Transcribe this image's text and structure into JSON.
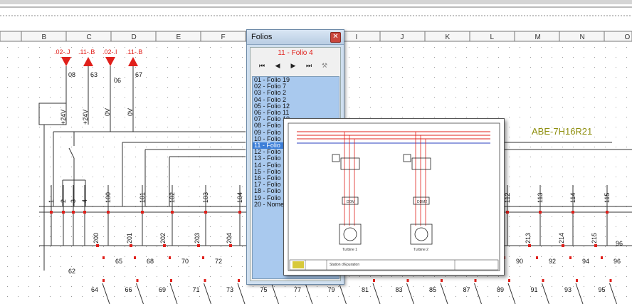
{
  "schematic": {
    "columns": [
      "B",
      "C",
      "D",
      "E",
      "F",
      "G",
      "H",
      "I",
      "J",
      "K",
      "L",
      "M",
      "N",
      "O"
    ],
    "top_refs": [
      {
        "text": ".02-.J",
        "color": "#e0201b"
      },
      {
        "text": ".11-.B",
        "color": "#e0201b"
      },
      {
        "text": ".02-.I",
        "color": "#e0201b"
      },
      {
        "text": ".11-.B",
        "color": "#e0201b"
      }
    ],
    "ref_numbers": [
      "08",
      "63",
      "06",
      "67"
    ],
    "supply_labels": [
      "+24V",
      "+24V",
      "0V",
      "0V"
    ],
    "reference_code": "ABE-7H16R21",
    "terminal_numbers": [
      "1",
      "2",
      "3",
      "4",
      "100",
      "101",
      "102",
      "103",
      "104",
      "112",
      "113",
      "114",
      "115"
    ],
    "lower_numbers": [
      "200",
      "201",
      "202",
      "203",
      "204",
      "213",
      "214",
      "215"
    ],
    "wire_numbers_row1": [
      "65",
      "68",
      "70",
      "72",
      "90",
      "92",
      "94",
      "96"
    ],
    "wire_numbers_row2": [
      "62"
    ],
    "wire_numbers_row3": [
      "64",
      "66",
      "69",
      "71",
      "73",
      "75",
      "77",
      "79",
      "81",
      "83",
      "85",
      "87",
      "89",
      "91",
      "93",
      "95"
    ],
    "right_edge_number": "96",
    "colors": {
      "red": "#e0201b",
      "reference": "#8f8f0f",
      "wire": "#333333",
      "grid_dot": "#9a9a9a"
    }
  },
  "dialog": {
    "title": "Folios",
    "current_folio": "11 - Folio 4",
    "selected_index": 10,
    "folios": [
      "01 - Folio 19",
      "02 - Folio 7",
      "03 - Folio 2",
      "04 - Folio 2",
      "05 - Folio 12",
      "06 - Folio 11",
      "07 - Folio 10",
      "08 - Folio",
      "09 - Folio",
      "10 - Folio",
      "11 - Folio",
      "12 - Folio",
      "13 - Folio",
      "14 - Folio",
      "15 - Folio",
      "16 - Folio",
      "17 - Folio",
      "18 - Folio",
      "19 - Folio",
      "20 - Nome"
    ],
    "nav_icons": [
      "first-icon",
      "prev-icon",
      "next-icon",
      "last-icon",
      "magic-wand-icon"
    ]
  },
  "preview": {
    "motor1_box": "DDM",
    "motor2_box": "DDM2",
    "motor1_label": "Turbine 1",
    "motor2_label": "Turbine 2",
    "title_block": "Station d'Epuration"
  }
}
